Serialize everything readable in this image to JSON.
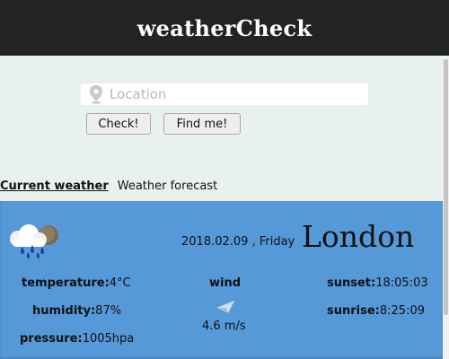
{
  "app": {
    "title": "weatherCheck"
  },
  "search": {
    "placeholder": "Location",
    "value": "",
    "check_label": "Check!",
    "find_label": "Find me!"
  },
  "tabs": [
    {
      "label": "Current weather",
      "active": true
    },
    {
      "label": "Weather forecast",
      "active": false
    }
  ],
  "weather": {
    "icon": "rain-cloud-sun-icon",
    "date": "2018.02.09 , Friday",
    "city": "London",
    "temperature": {
      "label": "temperature:",
      "value": "4°C"
    },
    "humidity": {
      "label": "humidity:",
      "value": "87%"
    },
    "pressure": {
      "label": "pressure:",
      "value": "1005hpa"
    },
    "wind": {
      "label": "wind",
      "speed": "4.6 m/s",
      "icon": "wind-direction-arrow-icon"
    },
    "sunset": {
      "label": "sunset:",
      "value": "18:05:03"
    },
    "sunrise": {
      "label": "sunrise:",
      "value": "8:25:09"
    }
  },
  "colors": {
    "header_bg": "#232323",
    "page_bg": "#e9f1ef",
    "panel_bg": "#5599d8"
  }
}
